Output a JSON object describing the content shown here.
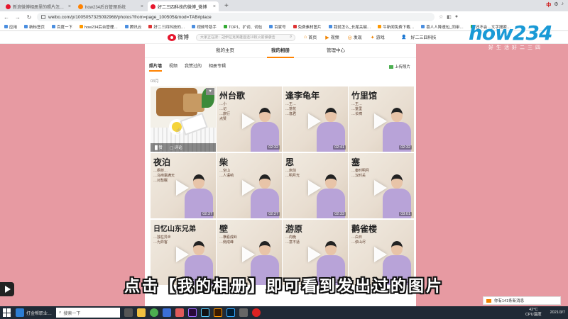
{
  "browser": {
    "tabs": [
      {
        "title": "新浪微博相册里的照片怎么删_百…",
        "active": false,
        "favicon": "weibo"
      },
      {
        "title": "how234后台管理系统",
        "active": false,
        "favicon": "orange"
      },
      {
        "title": "好二三四科技的微博_微博",
        "active": true,
        "favicon": "weibo"
      }
    ],
    "new_tab": "+",
    "url": "weibo.com/p/1005057325092968/photos?from=page_100505&mod=TAB#place",
    "bookmarks": [
      "应用",
      "新标签页",
      "百度一下",
      "how234后台管理…",
      "腾讯云",
      "好二三四科技的…",
      "视频号助手",
      "TOP1、扩词、词包",
      "百家号",
      "免费素材图片",
      "我就怎么_长尾关键…",
      "牛新闻免费下载…",
      "喜人人降速包_同审…",
      "还不会…文字搜索…"
    ],
    "tray_top": [
      "中",
      "⚙",
      "♪"
    ]
  },
  "weibo": {
    "logo_text": "微博",
    "search_placeholder": "大家正在搜：冠伊拉克英雄首选10枚火箭弹袭击",
    "nav": [
      {
        "icon": "home-icon",
        "glyph": "⌂",
        "label": "首页"
      },
      {
        "icon": "video-icon",
        "glyph": "▶",
        "label": "视频"
      },
      {
        "icon": "discover-icon",
        "glyph": "◎",
        "label": "发现"
      },
      {
        "icon": "game-icon",
        "glyph": "✦",
        "label": "游戏"
      }
    ],
    "username": "好二三四科技",
    "profile_tabs": [
      {
        "label": "我的主页",
        "active": false
      },
      {
        "label": "我的相册",
        "active": true
      },
      {
        "label": "管理中心",
        "active": false
      }
    ],
    "album_tabs": [
      {
        "label": "照片墙",
        "active": true
      },
      {
        "label": "视频",
        "active": false
      },
      {
        "label": "我赞过的",
        "active": false
      },
      {
        "label": "相册专辑",
        "active": false
      }
    ],
    "upload_label": "上传照片",
    "count_label": "03月",
    "photo_actions": [
      "█ 赞",
      "▢ 评论"
    ],
    "tiles": [
      {
        "kind": "photo"
      },
      {
        "kind": "video",
        "title": "州台歌",
        "sub": "…小\n…记\n…旅行\n点赞",
        "duration": "02:32"
      },
      {
        "kind": "video",
        "title": "逢李龟年",
        "sub": "…王…\n…落花\n…逢君",
        "duration": "02:41"
      },
      {
        "kind": "video",
        "title": "竹里馆",
        "sub": "…王…\n…篁里\n…长啸",
        "duration": "02:32"
      },
      {
        "kind": "video",
        "title": "夜泊",
        "sub": "…枫桥…\n…乌啼霜满天\n…对愁眠",
        "duration": "02:37"
      },
      {
        "kind": "video",
        "title": "柴",
        "sub": "…空山\n…人语响",
        "duration": "02:27"
      },
      {
        "kind": "video",
        "title": "思",
        "sub": "…床前\n…明月光",
        "duration": "02:33"
      },
      {
        "kind": "video",
        "title": "塞",
        "sub": "…秦时明月\n…汉时关",
        "duration": "03:01"
      },
      {
        "kind": "video",
        "title": "日忆山东兄弟",
        "sub": "…独在异乡\n…为异客",
        "duration": "02:40"
      },
      {
        "kind": "video",
        "title": "壁",
        "sub": "…横看成岭\n…侧成峰",
        "duration": "02:30"
      },
      {
        "kind": "video",
        "title": "游原",
        "sub": "…向晚\n…意不适",
        "duration": "02:35"
      },
      {
        "kind": "video",
        "title": "鹳雀楼",
        "sub": "…白日\n…依山尽",
        "duration": "02:28"
      }
    ]
  },
  "watermark": {
    "letters": "how234",
    "slogan": "好生活好二三四"
  },
  "caption": "点击【我的相册】即可看到发出过的图片",
  "notification": "你有141条新消息",
  "taskbar": {
    "search_placeholder": "搜索一下",
    "running_app": "打金帮职业…",
    "weather": "42°C\nCPU温度",
    "date": "2021/3/7"
  },
  "colors": {
    "weibo_red": "#e6162d",
    "weibo_orange": "#ff8200",
    "bg_pink": "#e79aa2",
    "brand_blue": "#1a9ad6",
    "taskbar": "#202a36"
  }
}
